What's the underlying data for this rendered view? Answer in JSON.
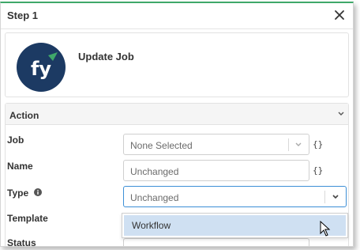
{
  "header": {
    "title": "Step 1",
    "close_icon": "close-icon"
  },
  "step": {
    "title": "Update Job",
    "logo_icon": "fym-logo",
    "logo_colors": {
      "background": "#1c3a63",
      "accent": "#3fa86a"
    }
  },
  "action": {
    "title": "Action",
    "fields": {
      "job": {
        "label": "Job",
        "value": "None Selected"
      },
      "name": {
        "label": "Name",
        "value": "Unchanged"
      },
      "type": {
        "label": "Type",
        "value": "Unchanged",
        "info_icon": "info-icon"
      },
      "template": {
        "label": "Template"
      },
      "status": {
        "label": "Status"
      }
    },
    "braces": "{}",
    "dropdown_options": [
      "Workflow"
    ]
  },
  "colors": {
    "accent_border": "#3fa86a",
    "focus": "#3d8fd6",
    "option_highlight": "#cfe0f2"
  }
}
